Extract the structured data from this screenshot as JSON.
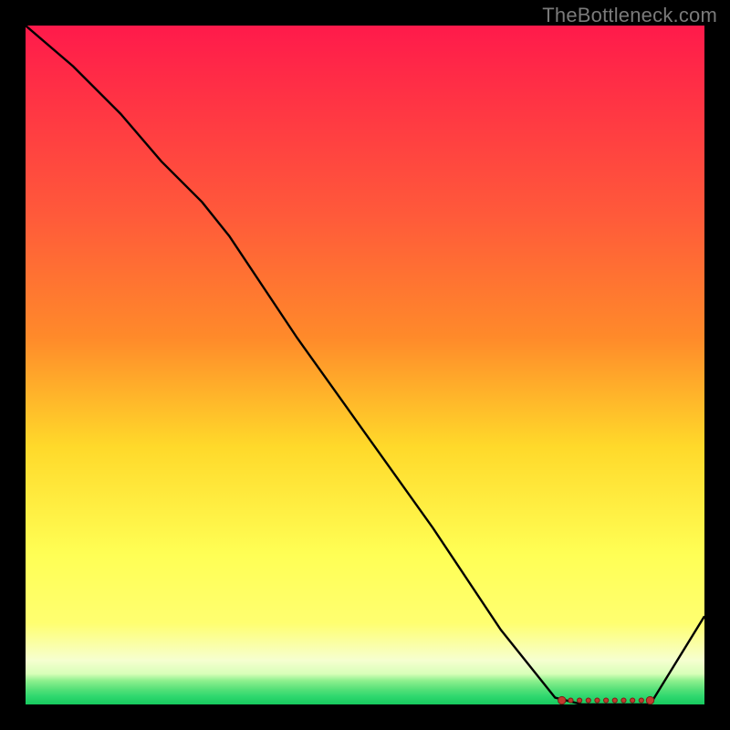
{
  "watermark": "TheBottleneck.com",
  "colors": {
    "frame": "#000000",
    "gradient_top": "#ff1a4b",
    "gradient_mid_high": "#ff8a2a",
    "gradient_mid": "#ffd92a",
    "gradient_mid_low": "#ffff70",
    "gradient_low": "#f6ffd0",
    "gradient_green1": "#8ef08e",
    "gradient_green2": "#2fd86f",
    "curve": "#000000",
    "marker_fill": "#c23a2e",
    "marker_stroke": "#7a1f17"
  },
  "chart_data": {
    "type": "line",
    "title": "",
    "xlabel": "",
    "ylabel": "",
    "xlim": [
      0,
      100
    ],
    "ylim": [
      0,
      100
    ],
    "grid": false,
    "legend": false,
    "series": [
      {
        "name": "curve",
        "x": [
          0,
          7,
          14,
          20,
          26,
          30,
          40,
          50,
          60,
          70,
          78,
          82,
          85,
          88,
          92,
          100
        ],
        "y": [
          100,
          94,
          87,
          80,
          74,
          69,
          54,
          40,
          26,
          11,
          1,
          0,
          0,
          0,
          0,
          13
        ]
      }
    ],
    "markers": {
      "x": [
        79,
        80.3,
        81.6,
        82.9,
        84.2,
        85.5,
        86.8,
        88.1,
        89.4,
        90.7,
        92
      ],
      "y": [
        0.6,
        0.6,
        0.6,
        0.6,
        0.6,
        0.6,
        0.6,
        0.6,
        0.6,
        0.6,
        0.6
      ]
    }
  }
}
